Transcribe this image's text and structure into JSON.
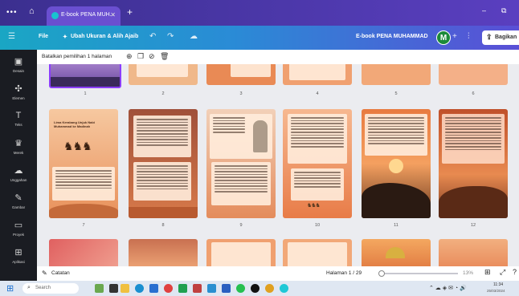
{
  "browser": {
    "tab_title": "E-book PENA MUH...",
    "window_controls": [
      "–",
      "⧉"
    ]
  },
  "toolbar": {
    "file_label": "File",
    "resize_label": "Ubah Ukuran & Alih Ajaib",
    "doc_title": "E-book PENA MUHAMMAD",
    "avatar_letter": "M",
    "share_label": "Bagikan"
  },
  "sidebar": {
    "items": [
      {
        "label": "Desain",
        "icon": "layout-icon"
      },
      {
        "label": "Elemen",
        "icon": "shapes-icon"
      },
      {
        "label": "Teks",
        "icon": "text-icon"
      },
      {
        "label": "Merek",
        "icon": "brand-icon"
      },
      {
        "label": "Unggahan",
        "icon": "cloud-upload-icon"
      },
      {
        "label": "Gambar",
        "icon": "draw-icon"
      },
      {
        "label": "Proyek",
        "icon": "folder-icon"
      },
      {
        "label": "Aplikasi",
        "icon": "apps-icon"
      }
    ]
  },
  "selection_bar": {
    "text": "Batalkan pemilihan 1 halaman"
  },
  "pages": {
    "row1_numbers": [
      "1",
      "2",
      "3",
      "4",
      "5",
      "6"
    ],
    "row2_numbers": [
      "7",
      "8",
      "9",
      "10",
      "11",
      "12"
    ],
    "page7_heading": "Lima Kerabang Unjuk Nabi Muhammad ke Madinah"
  },
  "bottom_bar": {
    "notes_label": "Catatan",
    "page_label": "Halaman 1 / 29",
    "zoom": "13%"
  },
  "taskbar": {
    "search_placeholder": "Search",
    "time": "11:34",
    "date": "25/03/2024"
  }
}
